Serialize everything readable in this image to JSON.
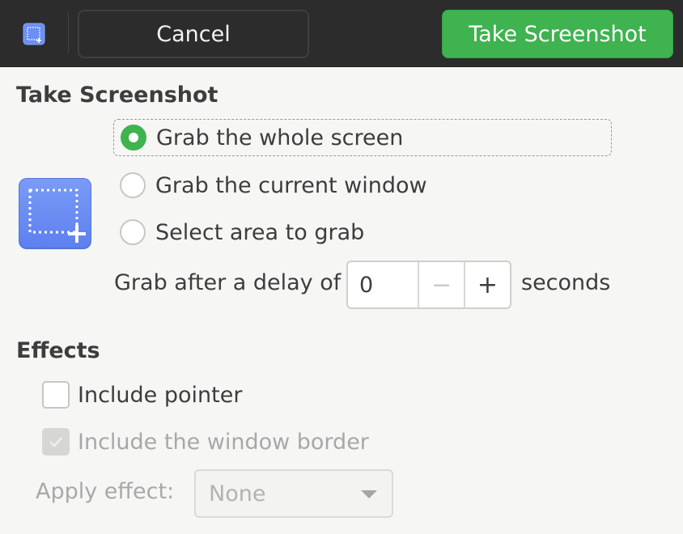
{
  "header": {
    "app_icon": "screenshot-area-icon",
    "cancel_label": "Cancel",
    "take_label": "Take Screenshot"
  },
  "take_section": {
    "title": "Take Screenshot",
    "icon": "screenshot-select-area-icon",
    "options": [
      {
        "label": "Grab the whole screen",
        "selected": true
      },
      {
        "label": "Grab the current window",
        "selected": false
      },
      {
        "label": "Select area to grab",
        "selected": false
      }
    ],
    "delay_label": "Grab after a delay of",
    "delay_value": "0",
    "delay_unit": "seconds"
  },
  "effects_section": {
    "title": "Effects",
    "include_pointer_label": "Include pointer",
    "include_pointer_checked": false,
    "include_border_label": "Include the window border",
    "include_border_checked": true,
    "apply_effect_label": "Apply effect:",
    "apply_effect_value": "None"
  },
  "colors": {
    "accent": "#3eb34f",
    "headerbar": "#2c2c2c",
    "icon_blue": "#6b8ff5"
  }
}
